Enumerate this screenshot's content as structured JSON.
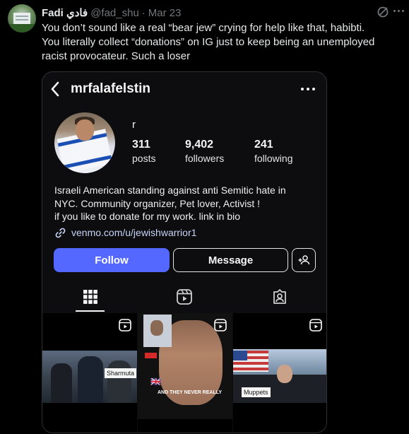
{
  "tweet": {
    "author_name": "Fadi فادي",
    "handle": "@fad_shu",
    "separator": "·",
    "date": "Mar 23",
    "text_lines": [
      "You don’t sound like a real “bear jew” crying for help like that, habibti.",
      "You literally collect “donations” on IG just to keep being an unemployed",
      "racist provocateur. Such a loser"
    ]
  },
  "instagram": {
    "username": "mrfalafelstin",
    "full_name": "r",
    "stats": {
      "posts": {
        "value": "311",
        "label": "posts"
      },
      "followers": {
        "value": "9,402",
        "label": "followers"
      },
      "following": {
        "value": "241",
        "label": "following"
      }
    },
    "bio_lines": [
      "Israeli American standing against anti Semitic hate in",
      "NYC. Community organizer, Pet lover, Activist !",
      "if you like to donate for my work. link in bio"
    ],
    "link": "venmo.com/u/jewishwarrior1",
    "buttons": {
      "follow": "Follow",
      "message": "Message"
    },
    "thumbnails": [
      {
        "caption": "Sharmuta"
      },
      {
        "caption_top": "",
        "caption_main": "AND THEY NEVER REALLY"
      },
      {
        "caption": "Muppets"
      }
    ]
  },
  "colors": {
    "follow_button": "#5468ff",
    "link_text": "#c7d3f6",
    "muted_text": "#71767b"
  },
  "icons": [
    "grok-icon",
    "more-icon",
    "back-chevron-icon",
    "link-icon",
    "add-person-icon",
    "grid-icon",
    "reels-icon",
    "tagged-icon",
    "reel-badge-icon"
  ]
}
